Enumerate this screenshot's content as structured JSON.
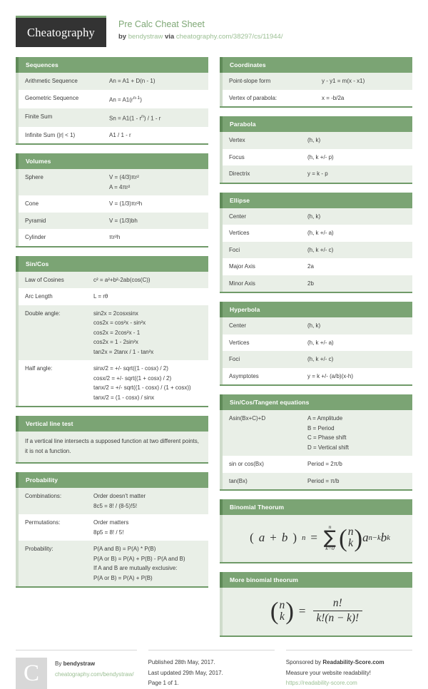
{
  "header": {
    "logo_text": "Cheatography",
    "title": "Pre Calc Cheat Sheet",
    "by_prefix": "by",
    "author": "bendystraw",
    "via": "via",
    "source_url": "cheatography.com/38297/cs/11944/"
  },
  "left_cards": [
    {
      "title": "Sequences",
      "label_width": "w-118",
      "rows": [
        {
          "k": "Arithmetic Sequence",
          "v": [
            "An = A1 + D(n - 1)"
          ]
        },
        {
          "k": "Geometric Sequence",
          "v": [
            "An = A1(r^n-1)"
          ]
        },
        {
          "k": "Finite Sum",
          "v": [
            "Sn = A1(1 - r^n) / 1 - r"
          ]
        },
        {
          "k": "Infinite Sum (|r| < 1)",
          "v": [
            "A1 / 1 - r"
          ]
        }
      ]
    },
    {
      "title": "Volumes",
      "label_width": "w-118",
      "rows": [
        {
          "k": "Sphere",
          "v": [
            "V = (4/3)πr²",
            "A = 4πr²"
          ]
        },
        {
          "k": "Cone",
          "v": [
            "V = (1/3)πr²h"
          ]
        },
        {
          "k": "Pyramid",
          "v": [
            "V = (1/3)bh"
          ]
        },
        {
          "k": "Cylinder",
          "v": [
            "πr²h"
          ]
        }
      ]
    },
    {
      "title": "Sin/Cos",
      "label_width": "w-96",
      "rows": [
        {
          "k": "Law of Cosines",
          "v": [
            "c² = a²+b²-2ab(cos(C))"
          ]
        },
        {
          "k": "Arc Length",
          "v": [
            "L = rθ"
          ]
        },
        {
          "k": "Double angle:",
          "v": [
            "sin2x = 2cosxsinx",
            "cos2x = cos²x - sin²x",
            "cos2x = 2cos²x - 1",
            "cos2x = 1 - 2sin²x",
            "tan2x = 2tanx / 1 - tan²x"
          ]
        },
        {
          "k": "Half angle:",
          "v": [
            "sinx/2 = +/- sqrt((1 - cosx) / 2)",
            "cosx/2 = +/- sqrt((1 + cosx) / 2)",
            "tanx/2 = +/- sqrt((1 - cosx) / (1 + cosx))",
            "tanx/2 = (1 - cosx) / sinx"
          ]
        }
      ]
    },
    {
      "title": "Vertical line test",
      "freetext": "If a vertical line intersects a supposed function at two different points, it is not a function."
    },
    {
      "title": "Probability",
      "label_width": "w-96",
      "rows": [
        {
          "k": "Combinations:",
          "v": [
            "Order doesn't matter",
            "8c5 = 8! / (8-5)!5!"
          ]
        },
        {
          "k": "Permutations:",
          "v": [
            "Order matters",
            "8p5 = 8! / 5!"
          ]
        },
        {
          "k": "Probability:",
          "v": [
            "P(A and B) = P(A) * P(B)",
            "P(A or B) = P(A) + P(B) - P(A and B)",
            "If A and B are mutually exclusive:",
            "P(A or B) = P(A) + P(B)"
          ]
        }
      ]
    }
  ],
  "right_cards": [
    {
      "title": "Coordinates",
      "label_width": "w-130",
      "rows": [
        {
          "k": "Point-slope form",
          "v": [
            "y - y1 = m(x - x1)"
          ]
        },
        {
          "k": "Vertex of parabola:",
          "v": [
            "x = -b/2a"
          ]
        }
      ]
    },
    {
      "title": "Parabola",
      "label_width": "w-110",
      "rows": [
        {
          "k": "Vertex",
          "v": [
            "(h, k)"
          ]
        },
        {
          "k": "Focus",
          "v": [
            "(h, k +/- p)"
          ]
        },
        {
          "k": "Directrix",
          "v": [
            "y = k - p"
          ]
        }
      ]
    },
    {
      "title": "Ellipse",
      "label_width": "w-110",
      "rows": [
        {
          "k": "Center",
          "v": [
            "(h, k)"
          ]
        },
        {
          "k": "Vertices",
          "v": [
            "(h, k +/- a)"
          ]
        },
        {
          "k": "Foci",
          "v": [
            "(h, k +/- c)"
          ]
        },
        {
          "k": "Major Axis",
          "v": [
            "2a"
          ]
        },
        {
          "k": "Minor Axis",
          "v": [
            "2b"
          ]
        }
      ]
    },
    {
      "title": "Hyperbola",
      "label_width": "w-110",
      "rows": [
        {
          "k": "Center",
          "v": [
            "(h, k)"
          ]
        },
        {
          "k": "Vertices",
          "v": [
            "(h, k +/- a)"
          ]
        },
        {
          "k": "Foci",
          "v": [
            "(h, k +/- c)"
          ]
        },
        {
          "k": "Asymptotes",
          "v": [
            "y = k +/- (a/b)(x-h)"
          ]
        }
      ]
    },
    {
      "title": "Sin/Cos/Tangent equations",
      "label_width": "w-110",
      "rows": [
        {
          "k": "Asin(Bx+C)+D",
          "v": [
            "A = Amplitude",
            "B = Period",
            "C = Phase shift",
            "D = Vertical shift"
          ]
        },
        {
          "k": "sin or cos(Bx)",
          "v": [
            "Period = 2π/b"
          ]
        },
        {
          "k": "tan(Bx)",
          "v": [
            "Period = π/b"
          ]
        }
      ]
    }
  ],
  "formula_cards": [
    {
      "title": "Binomial Theorum",
      "formula": "(a + b)^n = sum_{k=0}^{n} (n choose k) a^{n-k} b^k"
    },
    {
      "title": "More binomial theorum",
      "formula": "(n choose k) = n! / (k!(n - k)!)"
    }
  ],
  "formula_glyphs": {
    "a": "a",
    "b": "b",
    "n": "n",
    "k": "k",
    "plus": "+",
    "equals": "=",
    "k_eq_0": "k=0",
    "n_minus_k": "n−k",
    "n_fact": "n!",
    "k_fact_paren": "k!(n − k)!",
    "sigma": "∑"
  },
  "footer": {
    "avatar_letter": "C",
    "by_label": "By",
    "author": "bendystraw",
    "author_url": "cheatography.com/bendystraw/",
    "published": "Published 28th May, 2017.",
    "updated": "Last updated 29th May, 2017.",
    "page": "Page 1 of 1.",
    "sponsor_prefix": "Sponsored by",
    "sponsor_name": "Readability-Score.com",
    "sponsor_tagline": "Measure your website readability!",
    "sponsor_url": "https://readability-score.com"
  }
}
